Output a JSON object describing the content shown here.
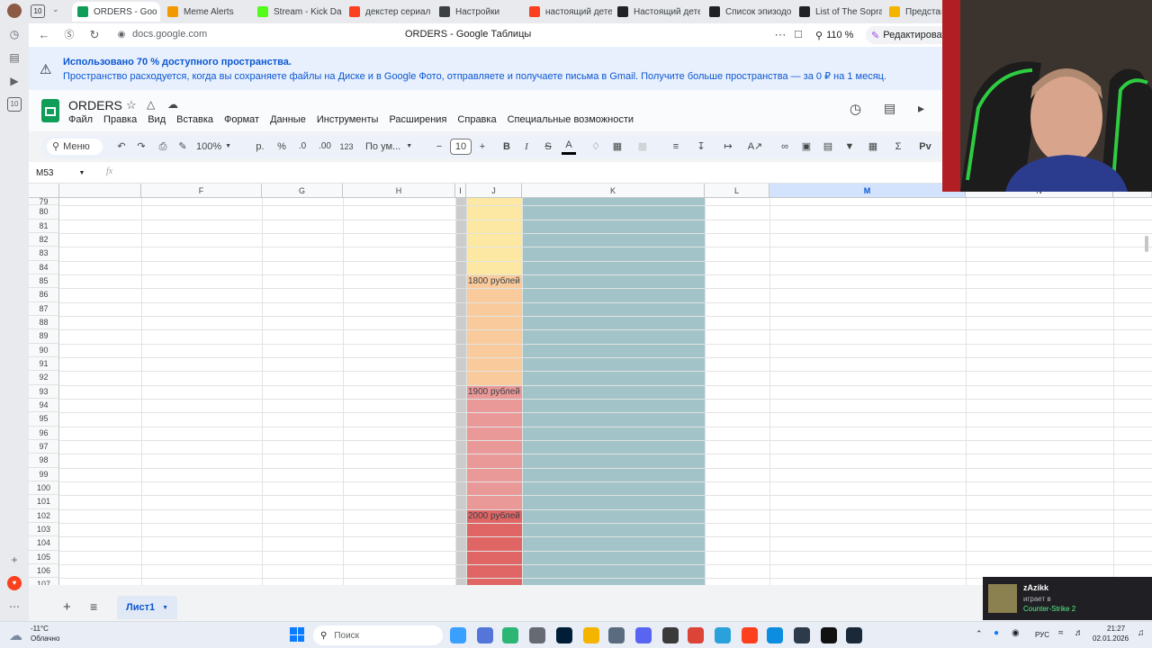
{
  "browser": {
    "tab_count": "10",
    "tabs": [
      {
        "label": "ORDERS - Goo",
        "icon": "sheets-icon",
        "color": "#0f9d58"
      },
      {
        "label": "Meme Alerts",
        "icon": "m-icon",
        "color": "#f29900"
      },
      {
        "label": "Stream - Kick Das",
        "icon": "kick-icon",
        "color": "#53fc18"
      },
      {
        "label": "декстер сериал -",
        "icon": "yandex-icon",
        "color": "#fc3f1d"
      },
      {
        "label": "Настройки",
        "icon": "gear-icon",
        "color": "#3c4043"
      },
      {
        "label": "настоящий детек",
        "icon": "yandex-icon",
        "color": "#fc3f1d"
      },
      {
        "label": "Настоящий детек",
        "icon": "wikipedia-icon",
        "color": "#202124"
      },
      {
        "label": "Список эпизодо",
        "icon": "wikipedia-icon",
        "color": "#202124"
      },
      {
        "label": "List of The Sopran",
        "icon": "wikipedia-icon",
        "color": "#202124"
      },
      {
        "label": "Представл",
        "icon": "folder-icon",
        "color": "#f4b400"
      }
    ],
    "url": "docs.google.com",
    "page_title": "ORDERS - Google Таблицы",
    "zoom": "110 %",
    "edit_label": "Редактироват"
  },
  "sidebar_badge": "10",
  "banner": {
    "title": "Использовано 70 % доступного пространства.",
    "text": "Пространство расходуется, когда вы сохраняете файлы на Диске и в Google Фото, отправляете и получаете письма в Gmail. Получите больше пространства — за 0 ₽ на 1 месяц."
  },
  "doc": {
    "title": "ORDERS",
    "menus": [
      "Файл",
      "Правка",
      "Вид",
      "Вставка",
      "Формат",
      "Данные",
      "Инструменты",
      "Расширения",
      "Справка",
      "Специальные возможности"
    ]
  },
  "toolbar": {
    "menu_label": "Меню",
    "zoom": "100%",
    "currency": "р.",
    "percent": "%",
    "dec_less": ".0",
    "dec_more": ".00",
    "number_format": "123",
    "font": "По ум...",
    "font_size": "10",
    "bold": "B",
    "italic": "I",
    "strike": "S",
    "text_color": "A"
  },
  "formula": {
    "cell_ref": "M53",
    "fx": "fx",
    "value": ""
  },
  "grid": {
    "columns": [
      {
        "label": "",
        "width": 91
      },
      {
        "label": "F",
        "width": 134
      },
      {
        "label": "G",
        "width": 90
      },
      {
        "label": "H",
        "width": 125
      },
      {
        "label": "I",
        "width": 12
      },
      {
        "label": "J",
        "width": 62
      },
      {
        "label": "K",
        "width": 203
      },
      {
        "label": "L",
        "width": 72
      },
      {
        "label": "M",
        "width": 218
      },
      {
        "label": "N",
        "width": 164
      },
      {
        "label": "",
        "width": 43
      }
    ],
    "rows": [
      "79",
      "80",
      "81",
      "82",
      "83",
      "84",
      "85",
      "86",
      "87",
      "88",
      "89",
      "90",
      "91",
      "92",
      "93",
      "94",
      "95",
      "96",
      "97",
      "98",
      "99",
      "100",
      "101",
      "102",
      "103",
      "104",
      "105",
      "106",
      "107"
    ],
    "prices": [
      {
        "row": "85",
        "label": "1800 рублей"
      },
      {
        "row": "93",
        "label": "1900 рублей"
      },
      {
        "row": "102",
        "label": "2000 рублей"
      }
    ],
    "colors": {
      "yellow": "#fce8a2",
      "orange": "#f9cb9c",
      "pink": "#ea9999",
      "red": "#e06666",
      "teal": "#a2c4c9",
      "col_i": "#cccccc"
    }
  },
  "sheetbar": {
    "sheet_name": "Лист1"
  },
  "notification": {
    "name": "zAzikk",
    "status": "играет в",
    "game": "Counter-Strike 2"
  },
  "taskbar": {
    "weather_temp": "-11°C",
    "weather_desc": "Облачно",
    "search_placeholder": "Поиск",
    "lang": "РУС",
    "time": "21:27",
    "date": "02.01.2026"
  }
}
